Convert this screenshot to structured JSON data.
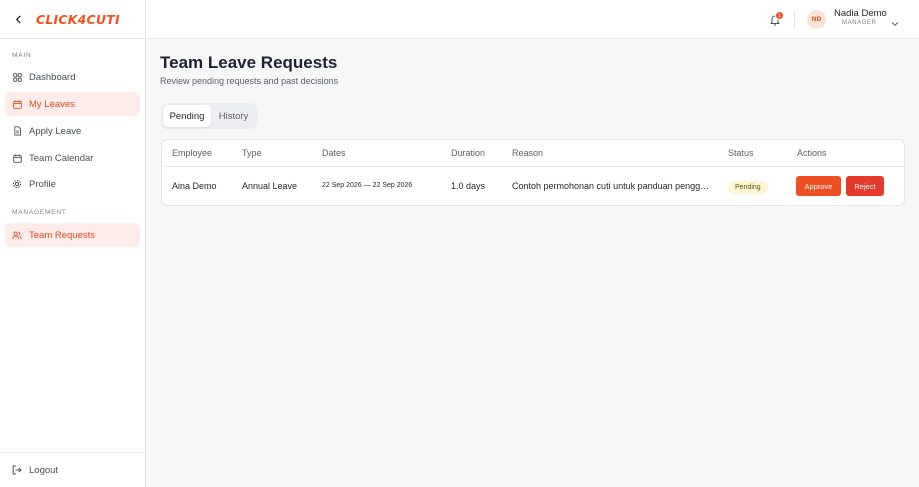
{
  "brand": {
    "logo_text": "CLICK4CUTI",
    "accent": "#f4511e"
  },
  "sidebar": {
    "section_main": "MAIN",
    "section_management": "MANAGEMENT",
    "items": [
      {
        "label": "Dashboard",
        "icon": "grid-icon"
      },
      {
        "label": "My Leaves",
        "icon": "calendar-icon",
        "active": true
      },
      {
        "label": "Apply Leave",
        "icon": "document-icon"
      },
      {
        "label": "Team Calendar",
        "icon": "calendar-icon"
      },
      {
        "label": "Profile",
        "icon": "gear-icon"
      }
    ],
    "management_items": [
      {
        "label": "Team Requests",
        "icon": "users-icon",
        "active": true
      }
    ],
    "logout_label": "Logout"
  },
  "header": {
    "notification_count": "1",
    "user": {
      "initials": "ND",
      "name": "Nadia Demo",
      "role": "MANAGER"
    }
  },
  "main": {
    "title": "Team Leave Requests",
    "subtitle": "Review pending requests and past decisions",
    "tabs": [
      {
        "label": "Pending",
        "active": true
      },
      {
        "label": "History",
        "active": false
      }
    ],
    "table": {
      "columns": [
        "Employee",
        "Type",
        "Dates",
        "Duration",
        "Reason",
        "Status",
        "Actions"
      ],
      "rows": [
        {
          "employee": "Aina Demo",
          "type": "Annual Leave",
          "dates": "22 Sep 2026 — 22 Sep 2026",
          "duration": "1.0 days",
          "reason": "Contoh permohonan cuti untuk panduan pengg…",
          "status": "Pending",
          "approve_label": "Approve",
          "reject_label": "Reject"
        }
      ]
    }
  }
}
